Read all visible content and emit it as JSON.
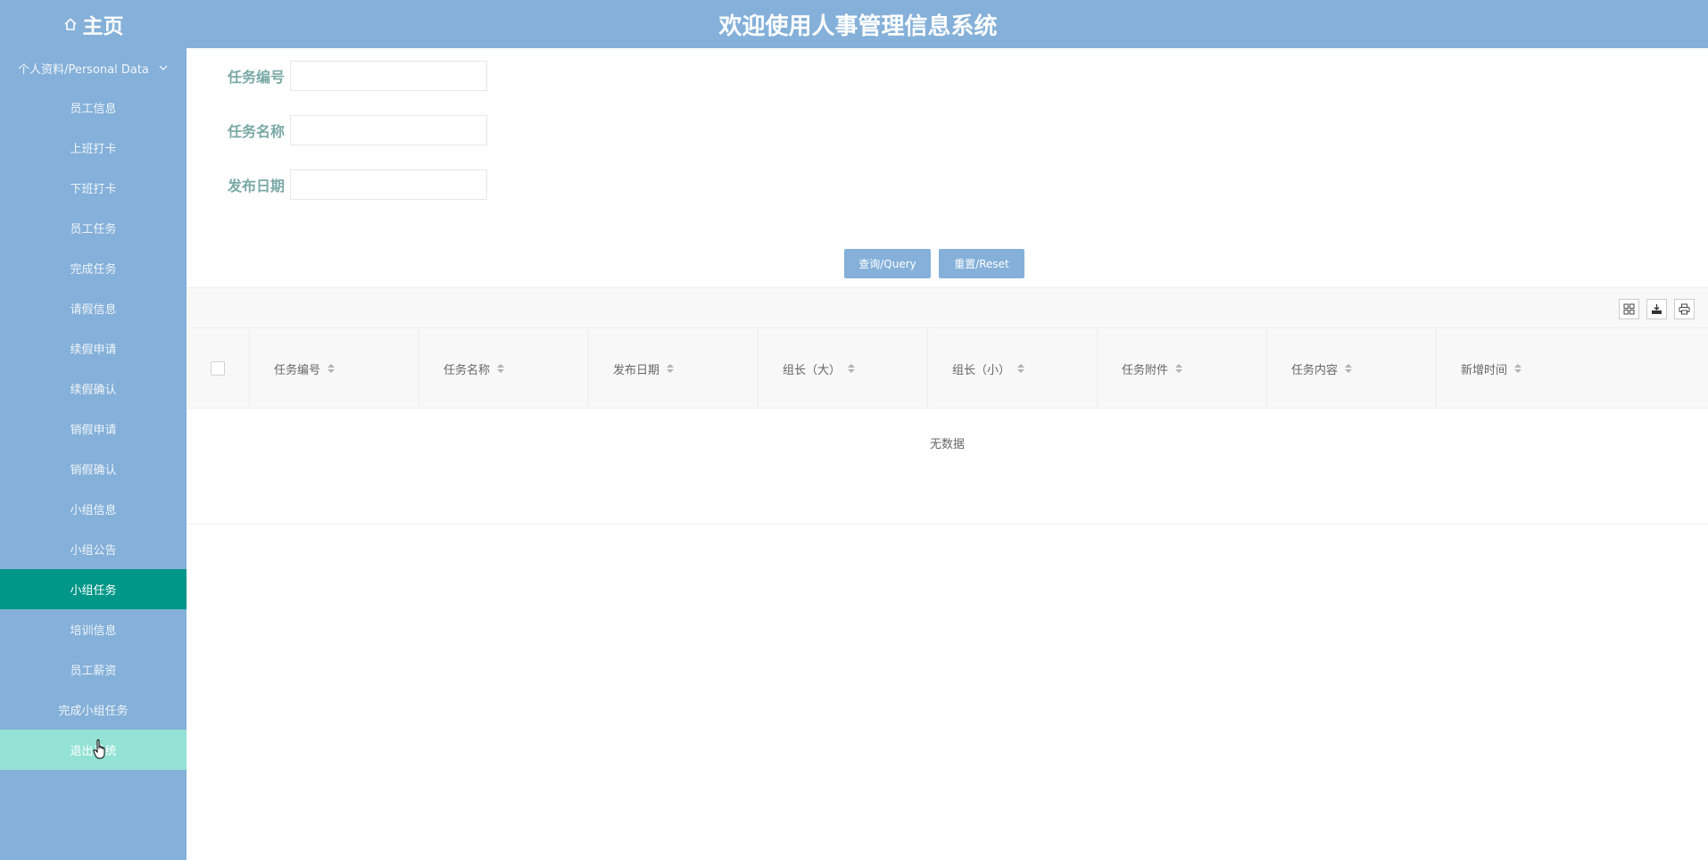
{
  "header": {
    "home_label": "主页",
    "title": "欢迎使用人事管理信息系统"
  },
  "sidebar": {
    "group_label": "个人资料/Personal Data",
    "items": [
      {
        "label": "员工信息"
      },
      {
        "label": "上班打卡"
      },
      {
        "label": "下班打卡"
      },
      {
        "label": "员工任务"
      },
      {
        "label": "完成任务"
      },
      {
        "label": "请假信息"
      },
      {
        "label": "续假申请"
      },
      {
        "label": "续假确认"
      },
      {
        "label": "销假申请"
      },
      {
        "label": "销假确认"
      },
      {
        "label": "小组信息"
      },
      {
        "label": "小组公告"
      },
      {
        "label": "小组任务"
      },
      {
        "label": "培训信息"
      },
      {
        "label": "员工薪资"
      },
      {
        "label": "完成小组任务"
      },
      {
        "label": "退出系统"
      }
    ],
    "active_item": "小组任务",
    "hovered_item": "退出系统"
  },
  "search_form": {
    "task_no_label": "任务编号",
    "task_no_value": "",
    "task_name_label": "任务名称",
    "task_name_value": "",
    "publish_date_label": "发布日期",
    "publish_date_value": "",
    "query_button": "查询/Query",
    "reset_button": "重置/Reset"
  },
  "table": {
    "toolbar_icons": [
      "columns-filter-icon",
      "export-icon",
      "print-icon"
    ],
    "columns": [
      "任务编号",
      "任务名称",
      "发布日期",
      "组长（大）",
      "组长（小）",
      "任务附件",
      "任务内容",
      "新增时间"
    ],
    "empty_text": "无数据"
  },
  "colors": {
    "primary": "#84b0d9",
    "active": "#009688",
    "hover": "#93e2d5",
    "label": "#7aa9a6"
  }
}
